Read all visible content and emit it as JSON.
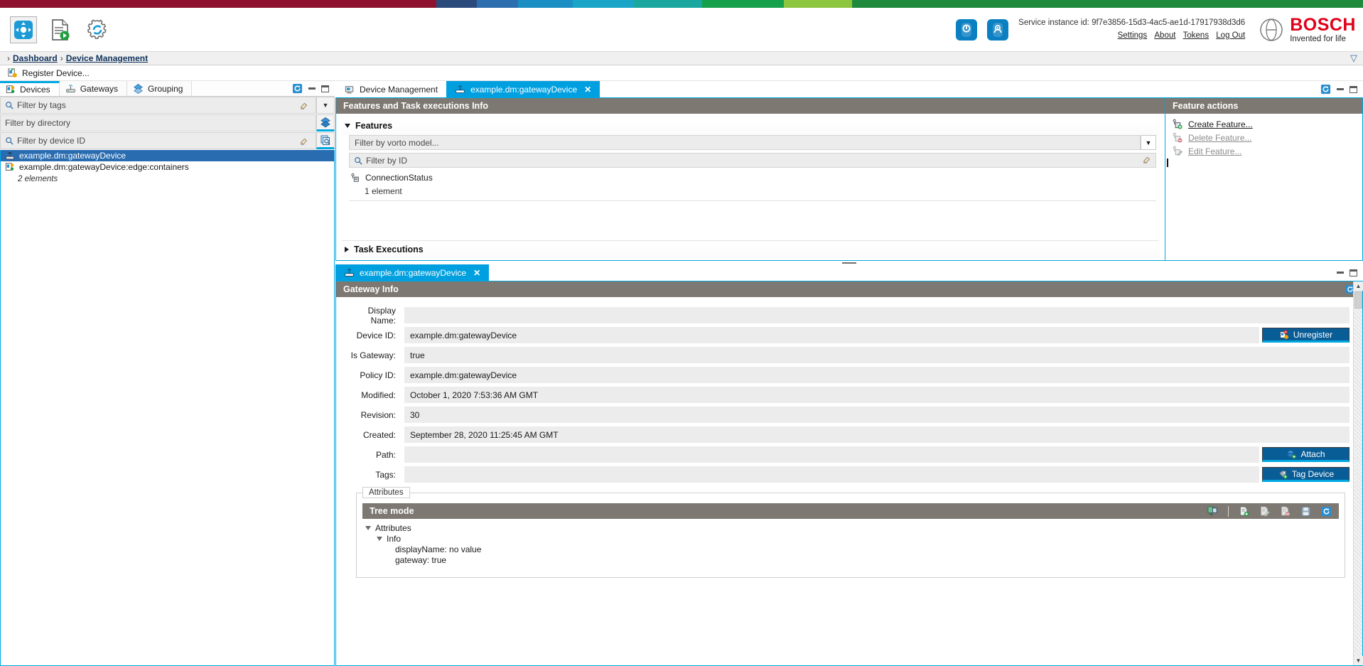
{
  "header": {
    "service_instance_label": "Service instance id: 9f7e3856-15d3-4ac5-ae1d-17917938d3d6",
    "links": [
      {
        "label": "Settings",
        "name": "settings-link"
      },
      {
        "label": "About",
        "name": "about-link"
      },
      {
        "label": "Tokens",
        "name": "tokens-link"
      },
      {
        "label": "Log Out",
        "name": "logout-link"
      }
    ],
    "brand": "BOSCH",
    "slogan": "Invented for life",
    "brand_color": "#e2001a",
    "accent_color": "#00a8e1"
  },
  "breadcrumb": {
    "items": [
      "Dashboard",
      "Device Management"
    ]
  },
  "toolbar": {
    "register_device_label": "Register Device..."
  },
  "left_view": {
    "tabs": [
      {
        "label": "Devices",
        "selected": true
      },
      {
        "label": "Gateways",
        "selected": false
      },
      {
        "label": "Grouping",
        "selected": false
      }
    ],
    "filters": [
      {
        "placeholder": "Filter by tags",
        "has_search_icon": true
      },
      {
        "placeholder": "Filter by directory",
        "has_search_icon": false
      },
      {
        "placeholder": "Filter by device ID",
        "has_search_icon": true
      }
    ],
    "tree_items": [
      {
        "label": "example.dm:gatewayDevice",
        "selected": true
      },
      {
        "label": "example.dm:gatewayDevice:edge:containers",
        "selected": false
      }
    ],
    "element_count": "2 elements"
  },
  "editor_tabs": [
    {
      "label": "Device Management",
      "selected": false,
      "closable": false
    },
    {
      "label": "example.dm:gatewayDevice",
      "selected": true,
      "closable": true
    }
  ],
  "features_panel": {
    "title": "Features and Task executions Info",
    "features_section": "Features",
    "vorto_filter_placeholder": "Filter by vorto model...",
    "id_filter_placeholder": "Filter by ID",
    "feature_name": "ConnectionStatus",
    "feature_count": "1 element",
    "task_executions_section": "Task Executions"
  },
  "feature_actions": {
    "title": "Feature actions",
    "items": [
      {
        "label": "Create Feature...",
        "enabled": true
      },
      {
        "label": "Delete Feature...",
        "enabled": false
      },
      {
        "label": "Edit Feature...",
        "enabled": false
      }
    ]
  },
  "gateway_editor": {
    "tab_label": "example.dm:gatewayDevice",
    "panel_title": "Gateway Info",
    "fields": [
      {
        "label": "Display Name:",
        "value": "",
        "button": null
      },
      {
        "label": "Device ID:",
        "value": "example.dm:gatewayDevice",
        "button": "Unregister"
      },
      {
        "label": "Is Gateway:",
        "value": "true",
        "button": null
      },
      {
        "label": "Policy ID:",
        "value": "example.dm:gatewayDevice",
        "button": null
      },
      {
        "label": "Modified:",
        "value": "October 1, 2020 7:53:36 AM GMT",
        "button": null
      },
      {
        "label": "Revision:",
        "value": "30",
        "button": null
      },
      {
        "label": "Created:",
        "value": "September 28, 2020 11:25:45 AM GMT",
        "button": null
      },
      {
        "label": "Path:",
        "value": "",
        "button": "Attach"
      },
      {
        "label": "Tags:",
        "value": "",
        "button": "Tag Device"
      }
    ],
    "attributes_legend": "Attributes",
    "tree_mode_title": "Tree mode",
    "tree_nodes": [
      {
        "label": "Attributes",
        "depth": 0,
        "expandable": true
      },
      {
        "label": "Info",
        "depth": 1,
        "expandable": true
      },
      {
        "label": "displayName: no value",
        "depth": 2,
        "expandable": false
      },
      {
        "label": "gateway: true",
        "depth": 2,
        "expandable": false
      }
    ]
  }
}
